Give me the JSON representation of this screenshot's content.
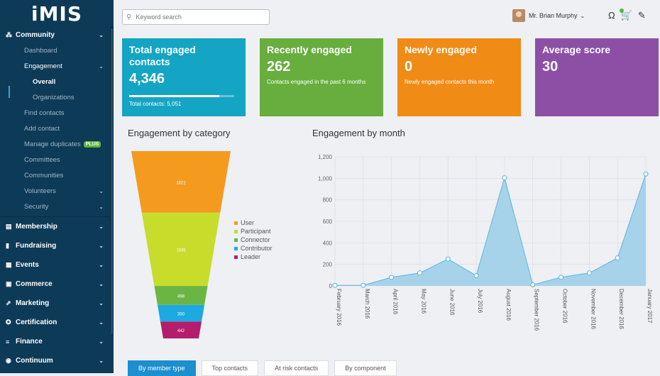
{
  "app": {
    "logo": "iMIS"
  },
  "sidebar": {
    "community": {
      "icon": "community-icon",
      "label": "Community"
    },
    "dashboard": "Dashboard",
    "engagement": "Engagement",
    "overall": "Overall",
    "organizations": "Organizations",
    "find_contacts": "Find contacts",
    "add_contact": "Add contact",
    "manage_duplicates": "Manage duplicates",
    "plus_badge": "PLUS",
    "committees": "Committees",
    "communities": "Communities",
    "volunteers": "Volunteers",
    "security": "Security",
    "groups": [
      {
        "icon": "membership-icon",
        "label": "Membership"
      },
      {
        "icon": "fundraising-icon",
        "label": "Fundraising"
      },
      {
        "icon": "events-icon",
        "label": "Events"
      },
      {
        "icon": "commerce-icon",
        "label": "Commerce"
      },
      {
        "icon": "marketing-icon",
        "label": "Marketing"
      },
      {
        "icon": "certification-icon",
        "label": "Certification"
      },
      {
        "icon": "finance-icon",
        "label": "Finance"
      },
      {
        "icon": "continuum-icon",
        "label": "Continuum"
      }
    ]
  },
  "topbar": {
    "search_placeholder": "Keyword search",
    "user_name": "Mr. Brian Murphy"
  },
  "cards": [
    {
      "title": "Total engaged contacts",
      "value": "4,346",
      "sub": "Total contacts: 5,051",
      "progress": 0.86,
      "color": "#13a5c3"
    },
    {
      "title": "Recently engaged",
      "value": "262",
      "sub": "Contacts engaged in the past 6 months",
      "color": "#67ae3e"
    },
    {
      "title": "Newly engaged",
      "value": "0",
      "sub": "Newly engaged contacts this month",
      "color": "#f08b16"
    },
    {
      "title": "Average score",
      "value": "30",
      "sub": "",
      "color": "#8d4fa6"
    }
  ],
  "sections": {
    "by_category": "Engagement by category",
    "by_month": "Engagement by month"
  },
  "chart_data": [
    {
      "type": "funnel",
      "title": "Engagement by category",
      "categories": [
        "User",
        "Participant",
        "Connector",
        "Contributor",
        "Leader"
      ],
      "values": [
        1621,
        1935,
        498,
        350,
        442
      ],
      "colors": [
        "#f39a1f",
        "#c8dc2c",
        "#6bb544",
        "#1da9e1",
        "#b41d6b"
      ],
      "legend": "right"
    },
    {
      "type": "area",
      "title": "Engagement by month",
      "x": [
        "February 2016",
        "March 2016",
        "April 2016",
        "May 2016",
        "June 2016",
        "July 2016",
        "August 2016",
        "September 2016",
        "October 2016",
        "November 2016",
        "December 2016",
        "January 2017"
      ],
      "values": [
        5,
        5,
        80,
        120,
        250,
        95,
        1005,
        10,
        80,
        120,
        260,
        1040
      ],
      "ylim": [
        0,
        1200
      ],
      "yticks": [
        "0",
        "200",
        "400",
        "600",
        "800",
        "1,000",
        "1,200"
      ],
      "grid": true,
      "color": "#a7d3ea",
      "line_color": "#5ab4e0"
    }
  ],
  "tabs": [
    "By member type",
    "Top contacts",
    "At risk contacts",
    "By component"
  ]
}
